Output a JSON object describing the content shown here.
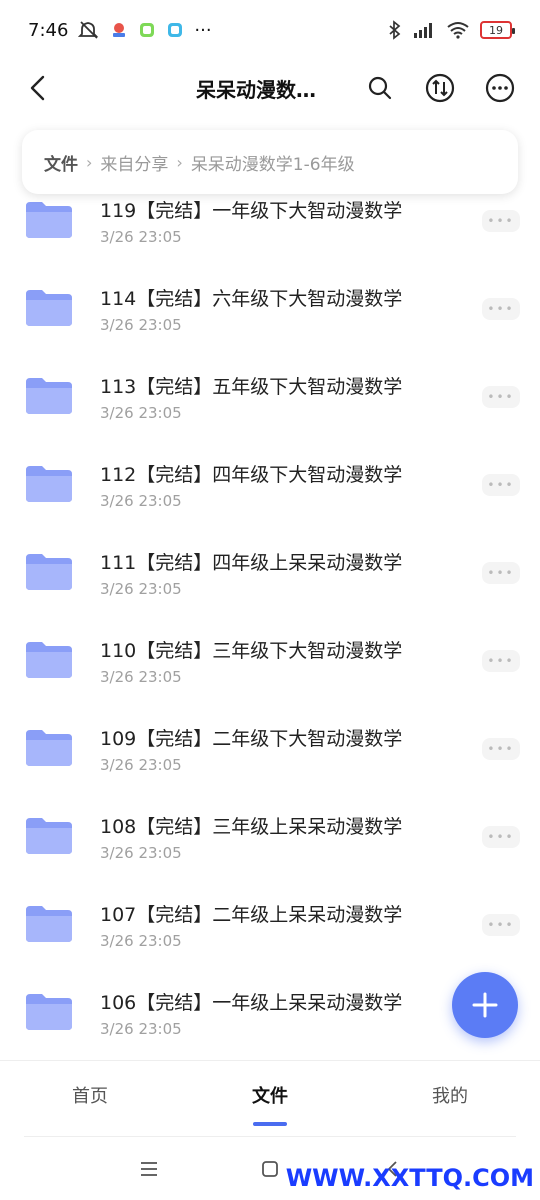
{
  "status_bar": {
    "time": "7:46",
    "more": "···",
    "battery": "19"
  },
  "header": {
    "title": "呆呆动漫数…"
  },
  "breadcrumb": {
    "root": "文件",
    "items": [
      "来自分享",
      "呆呆动漫数学1-6年级"
    ]
  },
  "files": [
    {
      "name": "119【完结】一年级下大智动漫数学",
      "date": "3/26 23:05"
    },
    {
      "name": "114【完结】六年级下大智动漫数学",
      "date": "3/26 23:05"
    },
    {
      "name": "113【完结】五年级下大智动漫数学",
      "date": "3/26 23:05"
    },
    {
      "name": "112【完结】四年级下大智动漫数学",
      "date": "3/26 23:05"
    },
    {
      "name": "111【完结】四年级上呆呆动漫数学",
      "date": "3/26 23:05"
    },
    {
      "name": "110【完结】三年级下大智动漫数学",
      "date": "3/26 23:05"
    },
    {
      "name": "109【完结】二年级下大智动漫数学",
      "date": "3/26 23:05"
    },
    {
      "name": "108【完结】三年级上呆呆动漫数学",
      "date": "3/26 23:05"
    },
    {
      "name": "107【完结】二年级上呆呆动漫数学",
      "date": "3/26 23:05"
    },
    {
      "name": "106【完结】一年级上呆呆动漫数学",
      "date": "3/26 23:05"
    }
  ],
  "tabs": [
    {
      "label": "首页"
    },
    {
      "label": "文件"
    },
    {
      "label": "我的"
    }
  ],
  "watermark": "WWW.XXTTQ.COM",
  "colors": {
    "accent": "#5b7cf5",
    "folder": "#8a9ef7",
    "battery_low": "#dd3333"
  },
  "icons": {
    "back": "back-arrow-icon",
    "search": "search-icon",
    "sort": "sort-icon",
    "more": "more-icon",
    "folder": "folder-icon",
    "add": "plus-icon"
  }
}
